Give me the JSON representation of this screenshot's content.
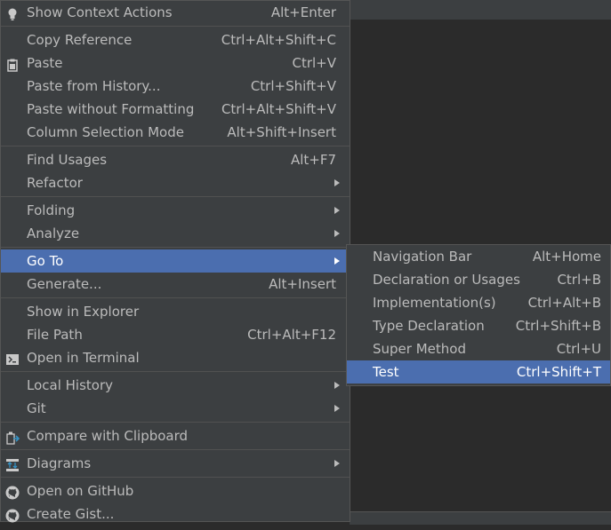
{
  "main_menu": {
    "groups": [
      [
        {
          "label": "Show Context Actions",
          "shortcut": "Alt+Enter",
          "icon": "bulb-icon"
        }
      ],
      [
        {
          "label": "Copy Reference",
          "shortcut": "Ctrl+Alt+Shift+C"
        },
        {
          "label": "Paste",
          "shortcut": "Ctrl+V",
          "icon": "clipboard-icon"
        },
        {
          "label": "Paste from History...",
          "shortcut": "Ctrl+Shift+V"
        },
        {
          "label": "Paste without Formatting",
          "shortcut": "Ctrl+Alt+Shift+V"
        },
        {
          "label": "Column Selection Mode",
          "shortcut": "Alt+Shift+Insert"
        }
      ],
      [
        {
          "label": "Find Usages",
          "shortcut": "Alt+F7"
        },
        {
          "label": "Refactor",
          "submenu": true
        }
      ],
      [
        {
          "label": "Folding",
          "submenu": true
        },
        {
          "label": "Analyze",
          "submenu": true
        }
      ],
      [
        {
          "label": "Go To",
          "submenu": true,
          "selected": true
        },
        {
          "label": "Generate...",
          "shortcut": "Alt+Insert"
        }
      ],
      [
        {
          "label": "Show in Explorer"
        },
        {
          "label": "File Path",
          "shortcut": "Ctrl+Alt+F12"
        },
        {
          "label": "Open in Terminal",
          "icon": "terminal-icon"
        }
      ],
      [
        {
          "label": "Local History",
          "submenu": true
        },
        {
          "label": "Git",
          "submenu": true
        }
      ],
      [
        {
          "label": "Compare with Clipboard",
          "icon": "compare-icon"
        }
      ],
      [
        {
          "label": "Diagrams",
          "submenu": true,
          "icon": "diagram-icon"
        }
      ],
      [
        {
          "label": "Open on GitHub",
          "icon": "github-icon"
        },
        {
          "label": "Create Gist...",
          "icon": "github-icon"
        }
      ]
    ]
  },
  "goto_submenu": {
    "items": [
      {
        "label": "Navigation Bar",
        "shortcut": "Alt+Home"
      },
      {
        "label": "Declaration or Usages",
        "shortcut": "Ctrl+B"
      },
      {
        "label": "Implementation(s)",
        "shortcut": "Ctrl+Alt+B"
      },
      {
        "label": "Type Declaration",
        "shortcut": "Ctrl+Shift+B"
      },
      {
        "label": "Super Method",
        "shortcut": "Ctrl+U"
      },
      {
        "label": "Test",
        "shortcut": "Ctrl+Shift+T",
        "selected": true
      }
    ]
  },
  "colors": {
    "menu_bg": "#3c3f41",
    "selection": "#4b6eaf",
    "text": "#bbbbbb",
    "editor_bg": "#2b2b2b"
  }
}
